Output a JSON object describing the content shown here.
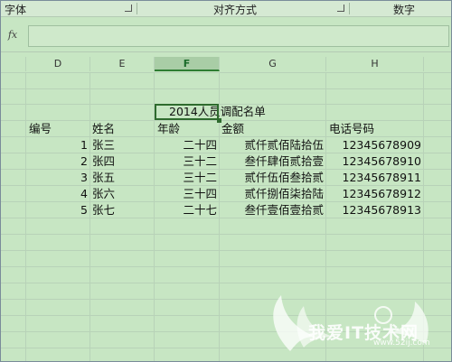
{
  "ribbon": {
    "group_font": "字体",
    "group_align": "对齐方式",
    "group_number": "数字"
  },
  "formula_bar": {
    "fx_label": "fx",
    "value": ""
  },
  "columns": [
    "D",
    "E",
    "F",
    "G",
    "H"
  ],
  "selected_column": "F",
  "sheet": {
    "title": "2014人员调配名单",
    "headers": {
      "id": "编号",
      "name": "姓名",
      "age": "年龄",
      "amount": "金额",
      "phone": "电话号码"
    },
    "rows": [
      {
        "id": "1",
        "name": "张三",
        "age": "二十四",
        "amount": "贰仟贰佰陆拾伍",
        "phone": "12345678909"
      },
      {
        "id": "2",
        "name": "张四",
        "age": "三十二",
        "amount": "叁仟肆佰贰拾壹",
        "phone": "12345678910"
      },
      {
        "id": "3",
        "name": "张五",
        "age": "三十二",
        "amount": "贰仟伍佰叁拾贰",
        "phone": "12345678911"
      },
      {
        "id": "4",
        "name": "张六",
        "age": "三十四",
        "amount": "贰仟捌佰柒拾陆",
        "phone": "12345678912"
      },
      {
        "id": "5",
        "name": "张七",
        "age": "二十七",
        "amount": "叁仟壹佰壹拾贰",
        "phone": "12345678913"
      }
    ]
  },
  "watermark": {
    "text": "我爱IT技术网",
    "url": "www.52ij.com"
  }
}
